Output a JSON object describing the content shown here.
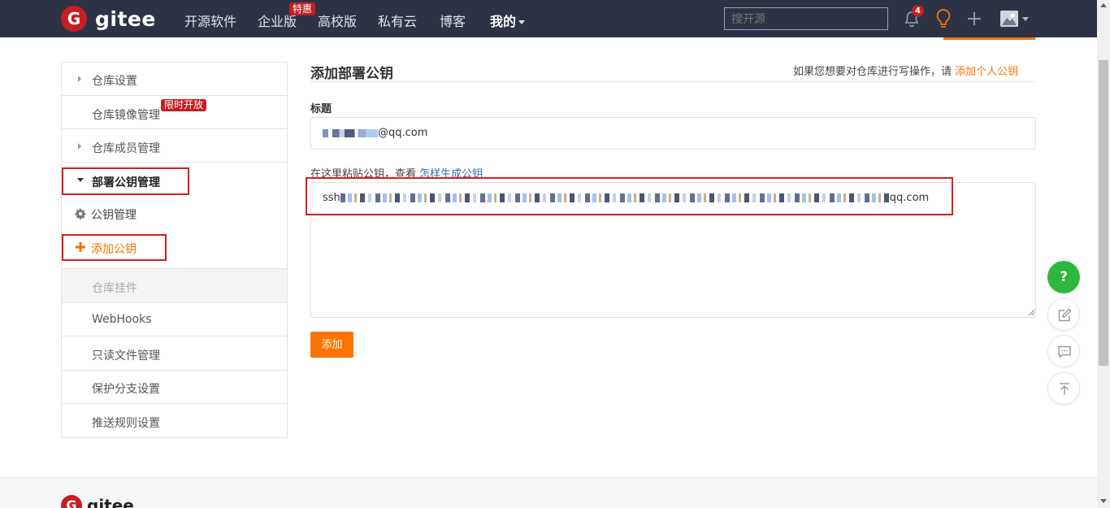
{
  "nav": {
    "logo_text": "gitee",
    "items": [
      "开源软件",
      "企业版",
      "高校版",
      "私有云",
      "博客",
      "我的"
    ],
    "enterprise_badge": "特惠",
    "search_placeholder": "搜开源",
    "notification_count": "4"
  },
  "sidebar": {
    "items": [
      {
        "label": "仓库设置"
      },
      {
        "label": "仓库镜像管理",
        "badge": "限时开放"
      },
      {
        "label": "仓库成员管理"
      },
      {
        "label": "部署公钥管理"
      },
      {
        "label": "公钥管理"
      },
      {
        "label": "添加公钥"
      },
      {
        "label": "仓库挂件"
      },
      {
        "label": "WebHooks"
      },
      {
        "label": "只读文件管理"
      },
      {
        "label": "保护分支设置"
      },
      {
        "label": "推送规则设置"
      }
    ]
  },
  "main": {
    "title": "添加部署公钥",
    "hint_prefix": "如果您想要对仓库进行写操作，请",
    "hint_link": "添加个人公钥",
    "title_label": "标题",
    "title_value_suffix": "@qq.com",
    "paste_label_prefix": "在这里粘贴公钥，查看",
    "paste_label_link": "怎样生成公钥",
    "key_prefix": "ssh",
    "key_suffix": "qq.com",
    "submit_label": "添加"
  },
  "float": {
    "help_label": "?"
  },
  "footer": {
    "logo_text": "gitee"
  },
  "colors": {
    "nav_bg": "#2c3345",
    "accent": "#fe7300",
    "brand_red": "#c71d23",
    "help_green": "#2eb73d",
    "highlight_red": "#d91d20"
  }
}
